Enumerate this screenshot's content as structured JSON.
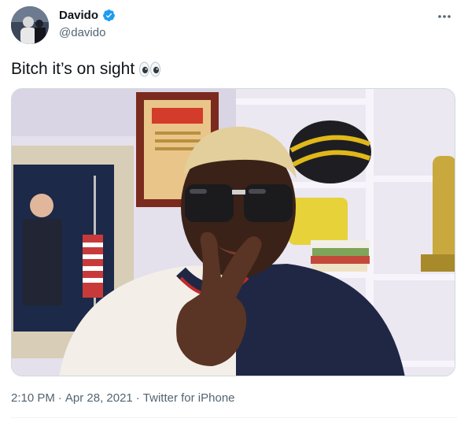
{
  "tweet": {
    "author": {
      "display_name": "Davido",
      "handle": "@davido",
      "verified": true
    },
    "text": "Bitch it’s on sight",
    "emoji": "eyes",
    "timestamp_time": "2:10 PM",
    "separator": "·",
    "timestamp_date": "Apr 28, 2021",
    "source": "Twitter for iPhone"
  },
  "colors": {
    "verified_badge": "#1d9bf0",
    "secondary_text": "#536471",
    "primary_text": "#0f1419"
  }
}
